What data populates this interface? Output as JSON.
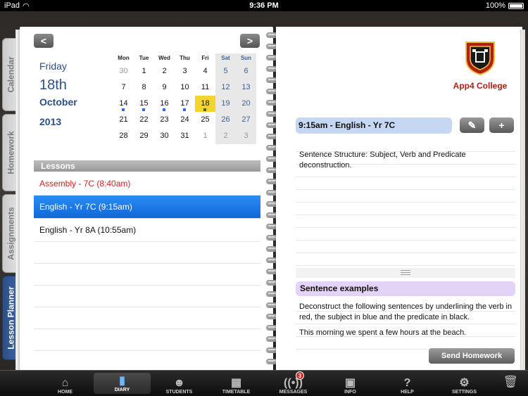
{
  "status": {
    "device": "iPad",
    "time": "9:36 PM",
    "battery": "100%"
  },
  "tabs": [
    {
      "label": "Calendar",
      "active": false
    },
    {
      "label": "Homework",
      "active": false
    },
    {
      "label": "Assignments",
      "active": false
    },
    {
      "label": "Lesson Planner",
      "active": true
    }
  ],
  "nav": {
    "prev": "<",
    "next": ">"
  },
  "date": {
    "weekday": "Friday",
    "day": "18th",
    "month": "October",
    "year": "2013"
  },
  "calendar": {
    "headers": [
      "Mon",
      "Tue",
      "Wed",
      "Thu",
      "Fri",
      "Sat",
      "Sun"
    ],
    "weeks": [
      [
        "30",
        "1",
        "2",
        "3",
        "4",
        "5",
        "6"
      ],
      [
        "7",
        "8",
        "9",
        "10",
        "11",
        "12",
        "13"
      ],
      [
        "14",
        "15",
        "16",
        "17",
        "18",
        "19",
        "20"
      ],
      [
        "21",
        "22",
        "23",
        "24",
        "25",
        "26",
        "27"
      ],
      [
        "28",
        "29",
        "30",
        "31",
        "1",
        "2",
        "3"
      ]
    ],
    "selected_day": "18"
  },
  "lessons": {
    "header": "Lessons",
    "items": [
      {
        "label": "Assembly - 7C (8:40am)",
        "color": "#d02020"
      },
      {
        "label": "English - Yr 7C (9:15am)",
        "selected": true
      },
      {
        "label": "English - Yr 8A (10:55am)"
      }
    ]
  },
  "school": {
    "name": "App4 College"
  },
  "lesson_detail": {
    "title": "9:15am - English - Yr 7C",
    "edit_icon": "pencil-icon",
    "add_icon": "plus-icon",
    "note": "Sentence Structure: Subject, Verb and Predicate deconstruction."
  },
  "examples": {
    "title": "Sentence examples",
    "paragraphs": [
      "Deconstruct the following sentences by underlining the verb in red, the subject in blue and the predicate in black.",
      "This morning we spent a few hours at the beach."
    ]
  },
  "send_button": "Send Homework",
  "toolbar": [
    {
      "label": "HOME",
      "icon": "home-icon"
    },
    {
      "label": "DIARY",
      "icon": "diary-icon",
      "active": true
    },
    {
      "label": "STUDENTS",
      "icon": "students-icon"
    },
    {
      "label": "TIMETABLE",
      "icon": "timetable-icon"
    },
    {
      "label": "MESSAGES",
      "icon": "messages-icon",
      "badge": "3"
    },
    {
      "label": "INFO",
      "icon": "info-icon"
    },
    {
      "label": "HELP",
      "icon": "help-icon"
    },
    {
      "label": "SETTINGS",
      "icon": "settings-icon"
    }
  ],
  "trash_icon": "trash-icon"
}
